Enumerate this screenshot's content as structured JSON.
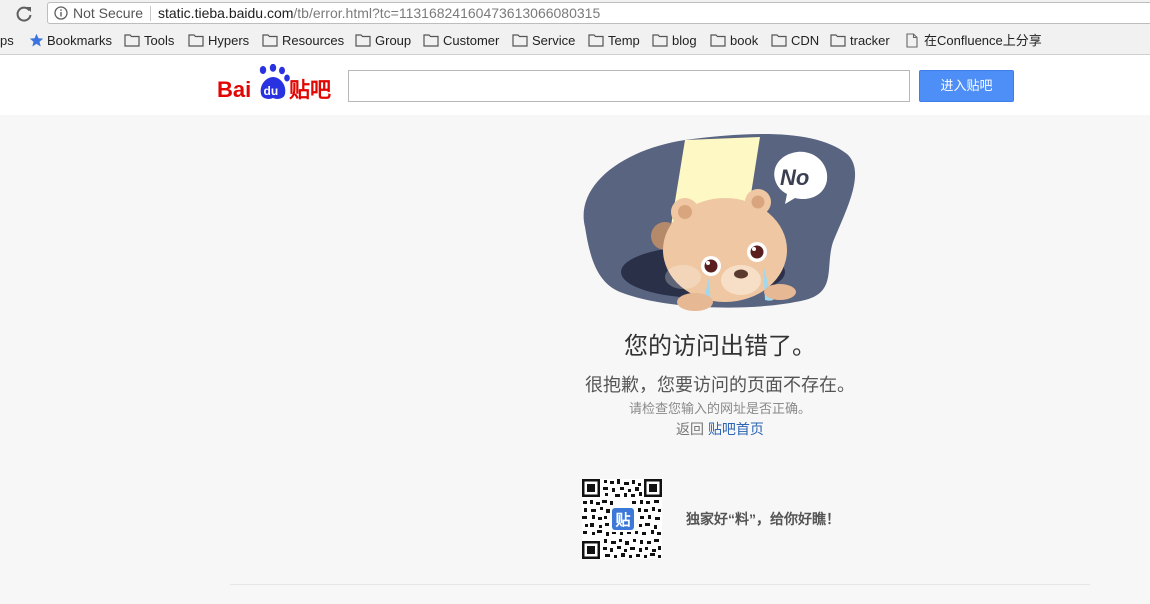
{
  "browser": {
    "not_secure_label": "Not Secure",
    "url_host": "static.tieba.baidu.com",
    "url_path": "/tb/error.html?tc=11316824160473613066080315"
  },
  "bookmarks": {
    "apps_label": "ps",
    "items": [
      {
        "label": "Bookmarks",
        "icon": "star-icon"
      },
      {
        "label": "Tools",
        "icon": "folder-icon"
      },
      {
        "label": "Hypers",
        "icon": "folder-icon"
      },
      {
        "label": "Resources",
        "icon": "folder-icon"
      },
      {
        "label": "Group",
        "icon": "folder-icon"
      },
      {
        "label": "Customer",
        "icon": "folder-icon"
      },
      {
        "label": "Service",
        "icon": "folder-icon"
      },
      {
        "label": "Temp",
        "icon": "folder-icon"
      },
      {
        "label": "blog",
        "icon": "folder-icon"
      },
      {
        "label": "book",
        "icon": "folder-icon"
      },
      {
        "label": "CDN",
        "icon": "folder-icon"
      },
      {
        "label": "tracker",
        "icon": "folder-icon"
      },
      {
        "label": "在Confluence上分享",
        "icon": "page-icon"
      }
    ]
  },
  "header": {
    "logo_text_bai": "Bai",
    "logo_text_du": "du",
    "logo_text_tieba": "贴吧",
    "search_value": "",
    "enter_button": "进入贴吧"
  },
  "error": {
    "bubble_text": "No",
    "title": "您的访问出错了。",
    "sorry": "很抱歉，您要访问的页面不存在。",
    "check": "请检查您输入的网址是否正确。",
    "back_prefix": "返回",
    "back_link": "贴吧首页"
  },
  "qr": {
    "badge": "贴",
    "caption": "独家好“料”，给你好瞧！"
  },
  "colors": {
    "accent": "#4e8ef7",
    "baidu_red": "#e10602",
    "baidu_blue": "#2932e1",
    "link": "#2d64b3"
  }
}
